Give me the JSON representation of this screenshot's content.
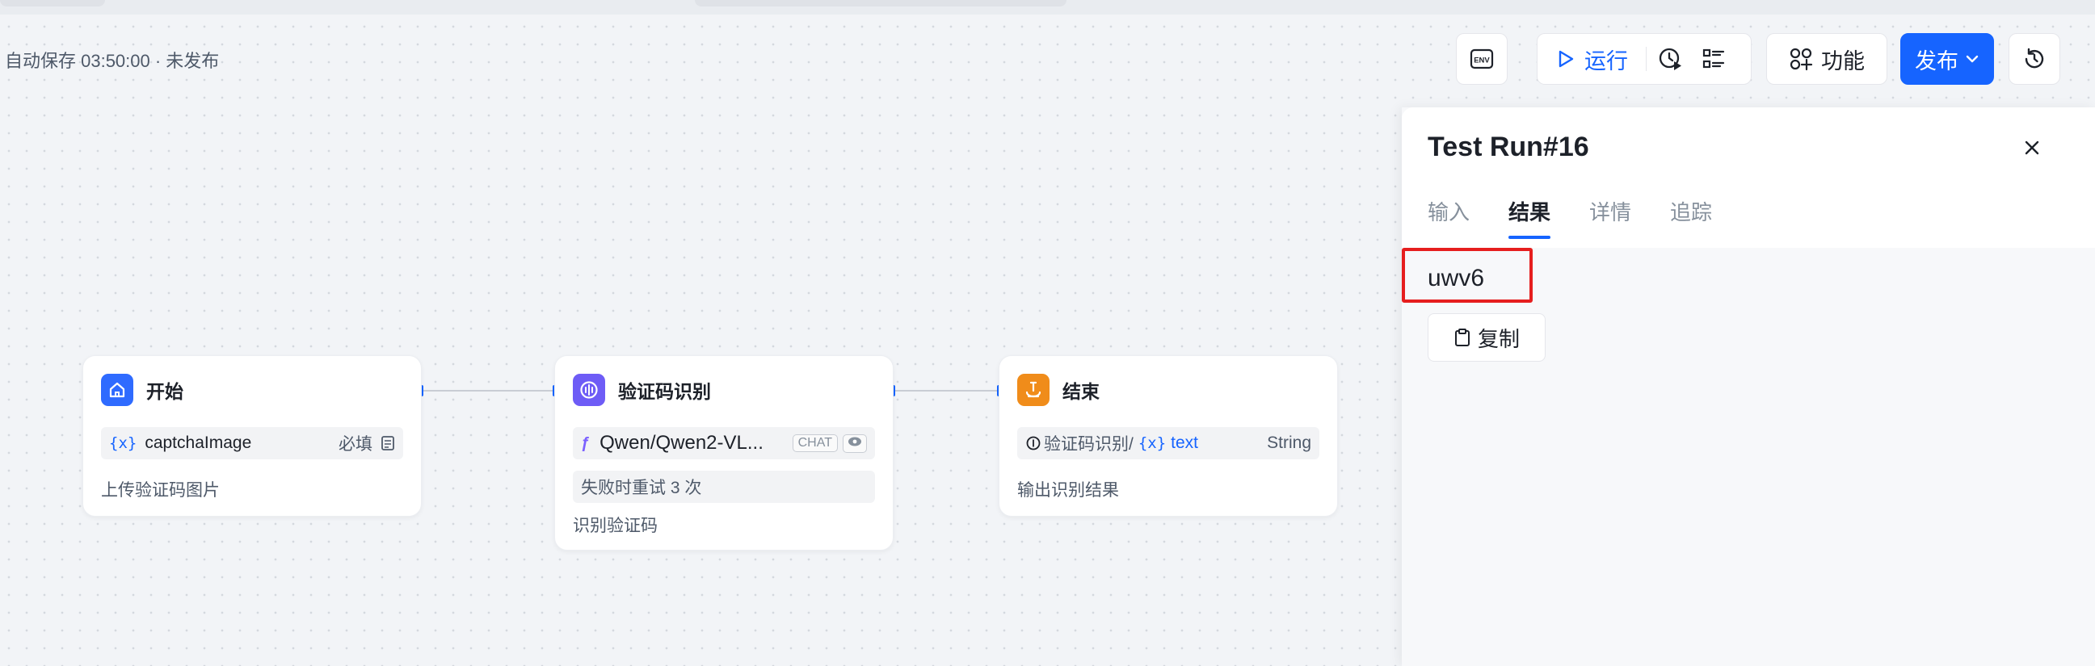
{
  "status": {
    "autosave": "自动保存 03:50:00 · 未发布"
  },
  "toolbar": {
    "env_label": "ENV",
    "run_label": "运行",
    "features_label": "功能",
    "publish_label": "发布",
    "accent_color": "#1664ff"
  },
  "nodes": [
    {
      "title": "开始",
      "icon": "home-icon",
      "icon_color": "#2f6bff",
      "row": {
        "name": "captchaImage",
        "required": "必填"
      },
      "description": "上传验证码图片"
    },
    {
      "title": "验证码识别",
      "icon": "llm-icon",
      "icon_color": "#6e5cf6",
      "model": {
        "name": "Qwen/Qwen2-VL...",
        "tag": "CHAT"
      },
      "retry": "失败时重试 3 次",
      "description": "识别验证码"
    },
    {
      "title": "结束",
      "icon": "end-icon",
      "icon_color": "#f08c1a",
      "row": {
        "source": "验证码识别/",
        "var": "text",
        "type": "String"
      },
      "description": "输出识别结果"
    }
  ],
  "panel": {
    "title": "Test Run#16",
    "tabs": [
      "输入",
      "结果",
      "详情",
      "追踪"
    ],
    "active_tab": "结果",
    "result": "uwv6",
    "copy_label": "复制",
    "highlight_color": "#e61e1e"
  }
}
